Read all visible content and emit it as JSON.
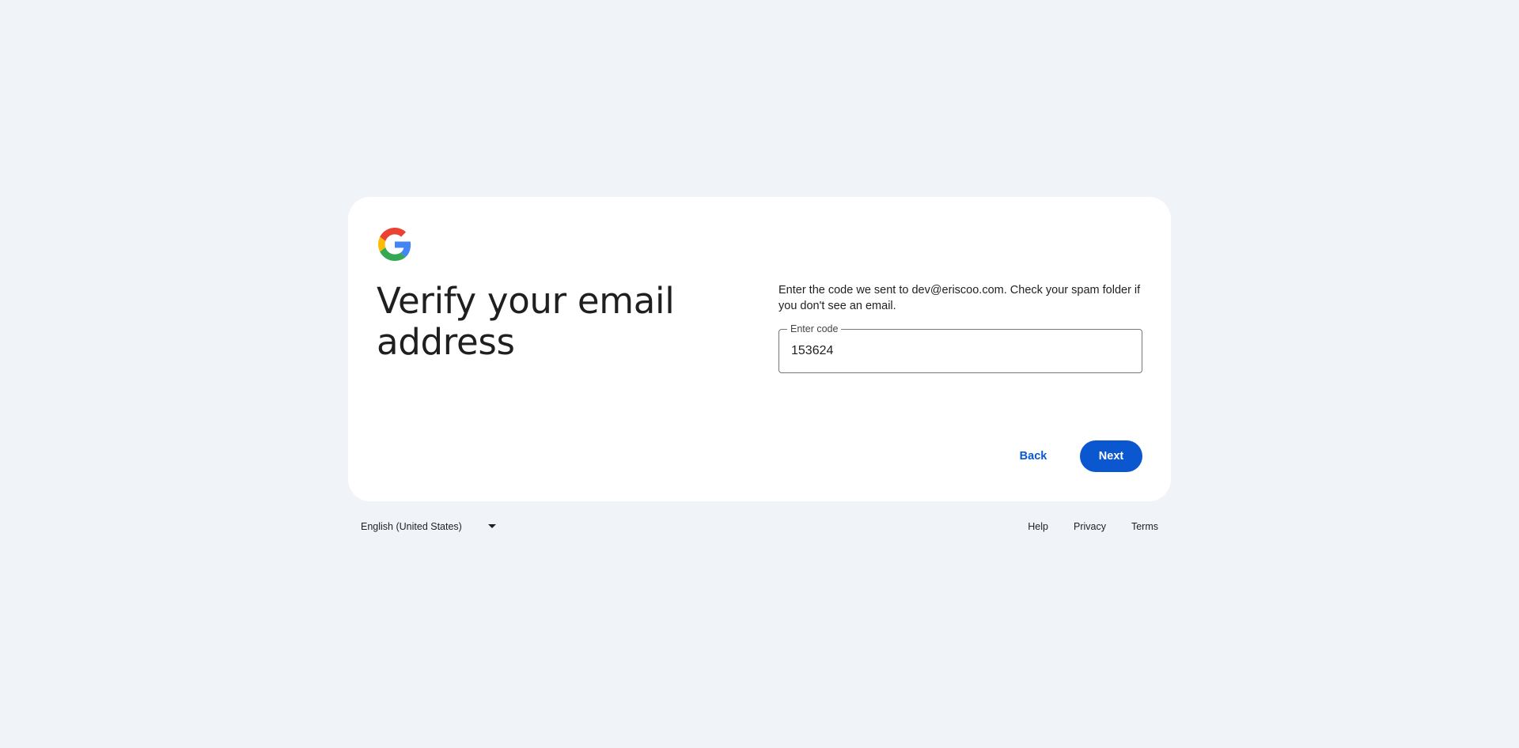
{
  "page": {
    "title": "Verify your email address",
    "instructions": "Enter the code we sent to dev@eriscoo.com. Check your spam folder if you don't see an email."
  },
  "code_field": {
    "label": "Enter code",
    "value": "153624"
  },
  "actions": {
    "back_label": "Back",
    "next_label": "Next"
  },
  "footer": {
    "language": "English (United States)",
    "links": {
      "help": "Help",
      "privacy": "Privacy",
      "terms": "Terms"
    }
  },
  "colors": {
    "background": "#f0f4f9",
    "card": "#ffffff",
    "primary": "#0b57d0",
    "text": "#1f1f1f"
  },
  "icons": {
    "logo": "google-g-logo-icon",
    "language_caret": "caret-down-icon"
  }
}
